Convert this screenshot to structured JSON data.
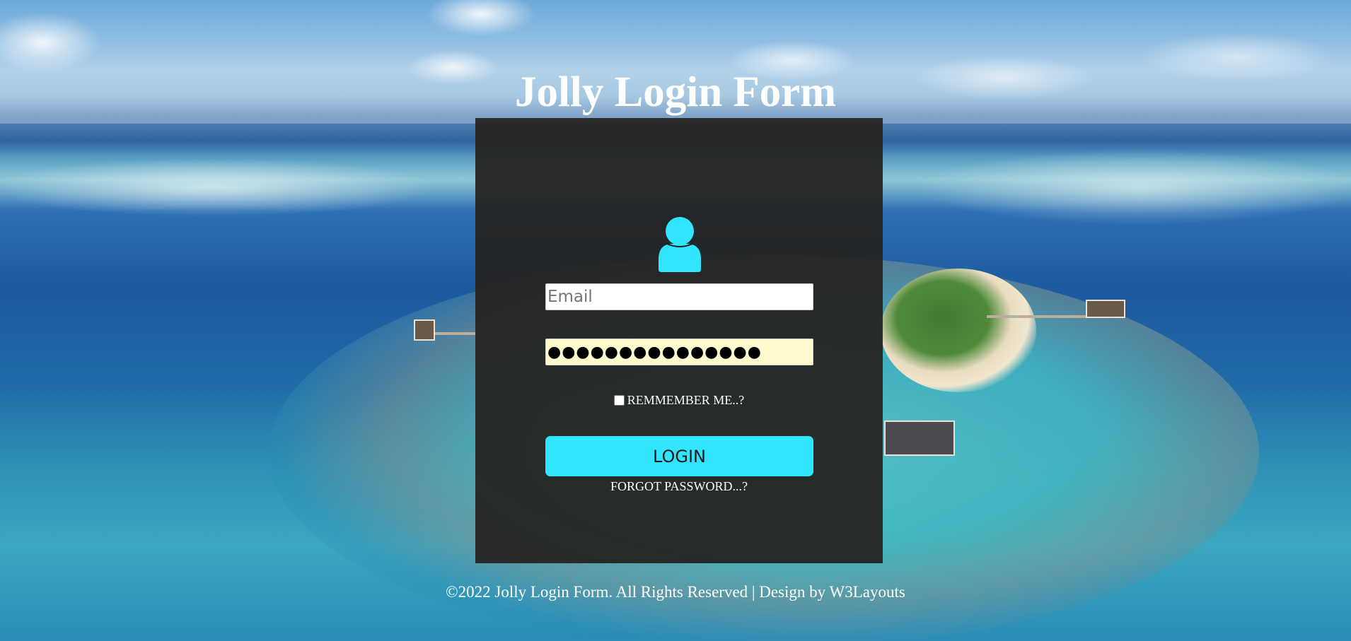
{
  "page": {
    "title": "Jolly Login Form"
  },
  "form": {
    "email_placeholder": "Email",
    "password_value": "●●●●●●●●●●●●●●●",
    "remember_label": "REMMEMBER ME..?",
    "remember_checked": false,
    "login_label": "LOGIN",
    "forgot_label": "FORGOT PASSWORD...?",
    "avatar_icon": "user-icon",
    "accent_color": "#32e5ff"
  },
  "footer": {
    "text": "©2022 Jolly Login Form. All Rights Reserved | Design by W3Layouts"
  }
}
